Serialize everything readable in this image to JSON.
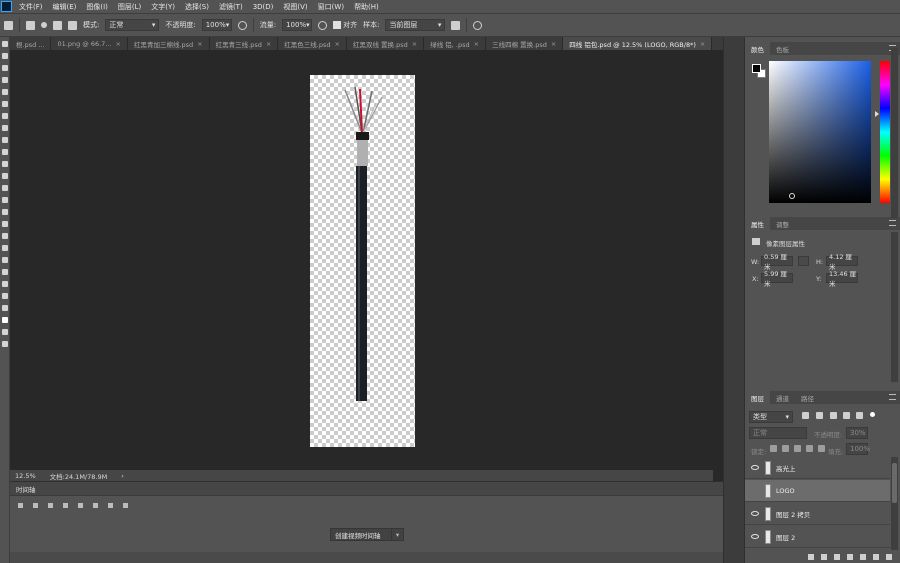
{
  "menu": [
    "文件(F)",
    "编辑(E)",
    "图像(I)",
    "图层(L)",
    "文字(Y)",
    "选择(S)",
    "滤镜(T)",
    "3D(D)",
    "视图(V)",
    "窗口(W)",
    "帮助(H)"
  ],
  "options": {
    "mode_label": "模式:",
    "mode_value": "正常",
    "opacity_label": "不透明度:",
    "opacity_value": "100%",
    "flow_label": "流量:",
    "flow_value": "100%",
    "align_label": "对齐",
    "sample_label": "样本:",
    "sample_value": "当前图层"
  },
  "tabs": [
    {
      "label": "根.psd ..."
    },
    {
      "label": "01.png @ 66.7..."
    },
    {
      "label": "红黑青加三棉线.psd"
    },
    {
      "label": "红黑青三线.psd"
    },
    {
      "label": "红黑色三线.psd"
    },
    {
      "label": "红黑双线 置换.psd"
    },
    {
      "label": "绿线 铝, .psd"
    },
    {
      "label": "三线四棉 置换.psd"
    },
    {
      "label": "四线 铝包.psd @ 12.5% (LOGO, RGB/8*)",
      "active": true
    }
  ],
  "status": {
    "zoom": "12.5%",
    "doc": "文档:24.1M/78.9M"
  },
  "timeline": {
    "title": "时间轴",
    "create_button": "创建视频时间轴"
  },
  "color_panel": {
    "tabs": [
      "颜色",
      "色板"
    ]
  },
  "properties_panel": {
    "tabs": [
      "属性",
      "调整"
    ],
    "section": "像素图层属性",
    "w_label": "W:",
    "w_value": "0.59 厘米",
    "h_label": "H:",
    "h_value": "4.12 厘米",
    "x_label": "X:",
    "x_value": "5.99 厘米",
    "y_label": "Y:",
    "y_value": "13.46 厘米"
  },
  "layers_panel": {
    "tabs": [
      "图层",
      "通道",
      "路径"
    ],
    "filter_label": "类型",
    "blend_mode": "正常",
    "opacity_label": "不透明度:",
    "opacity_value": "30%",
    "lock_label": "锁定:",
    "fill_label": "填充:",
    "fill_value": "100%",
    "layers": [
      {
        "name": "高光上",
        "visible": true
      },
      {
        "name": "LOGO",
        "visible": false,
        "selected": true
      },
      {
        "name": "图层 2 拷贝",
        "visible": true
      },
      {
        "name": "图层 2",
        "visible": true
      }
    ]
  },
  "colors": {
    "accent": "#31a8ff",
    "panel": "#535353",
    "canvas": "#282828"
  }
}
